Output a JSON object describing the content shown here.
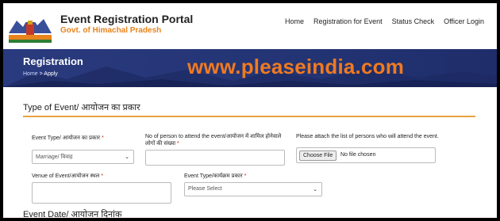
{
  "header": {
    "title": "Event Registration Portal",
    "subtitle": "Govt. of Himachal Pradesh"
  },
  "nav": {
    "items": [
      "Home",
      "Registration for Event",
      "Status Check",
      "Officer Login"
    ]
  },
  "banner": {
    "title": "Registration",
    "breadcrumb_home": "Home",
    "breadcrumb_sep": " > ",
    "breadcrumb_current": "Apply",
    "watermark": "www.pleaseindia.com"
  },
  "form": {
    "section_title": "Type of Event/ आयोजन का प्रकार",
    "event_type_label": "Event Type/ आयोजन का प्रकार",
    "event_type_value": "Marriage/ विवाह",
    "persons_label": "No of person to attend the event/आयोजन में शामिल होनेवाले लोगों की संख्या",
    "attach_label": "Please attach the list of persons who will attend the event.",
    "file_button": "Choose File",
    "file_status": "No file chosen",
    "venue_label": "Venue of Event/आयोजन स्थल",
    "event_type2_label": "Event Type/कार्यक्रम प्रकार",
    "event_type2_value": "Please Select",
    "required_mark": "*",
    "section2_title": "Event Date/ आयोजन दिनांक"
  },
  "colors": {
    "accent": "#e8841e",
    "banner": "#233474",
    "watermark": "#f07a20",
    "rule": "#e8a040"
  }
}
